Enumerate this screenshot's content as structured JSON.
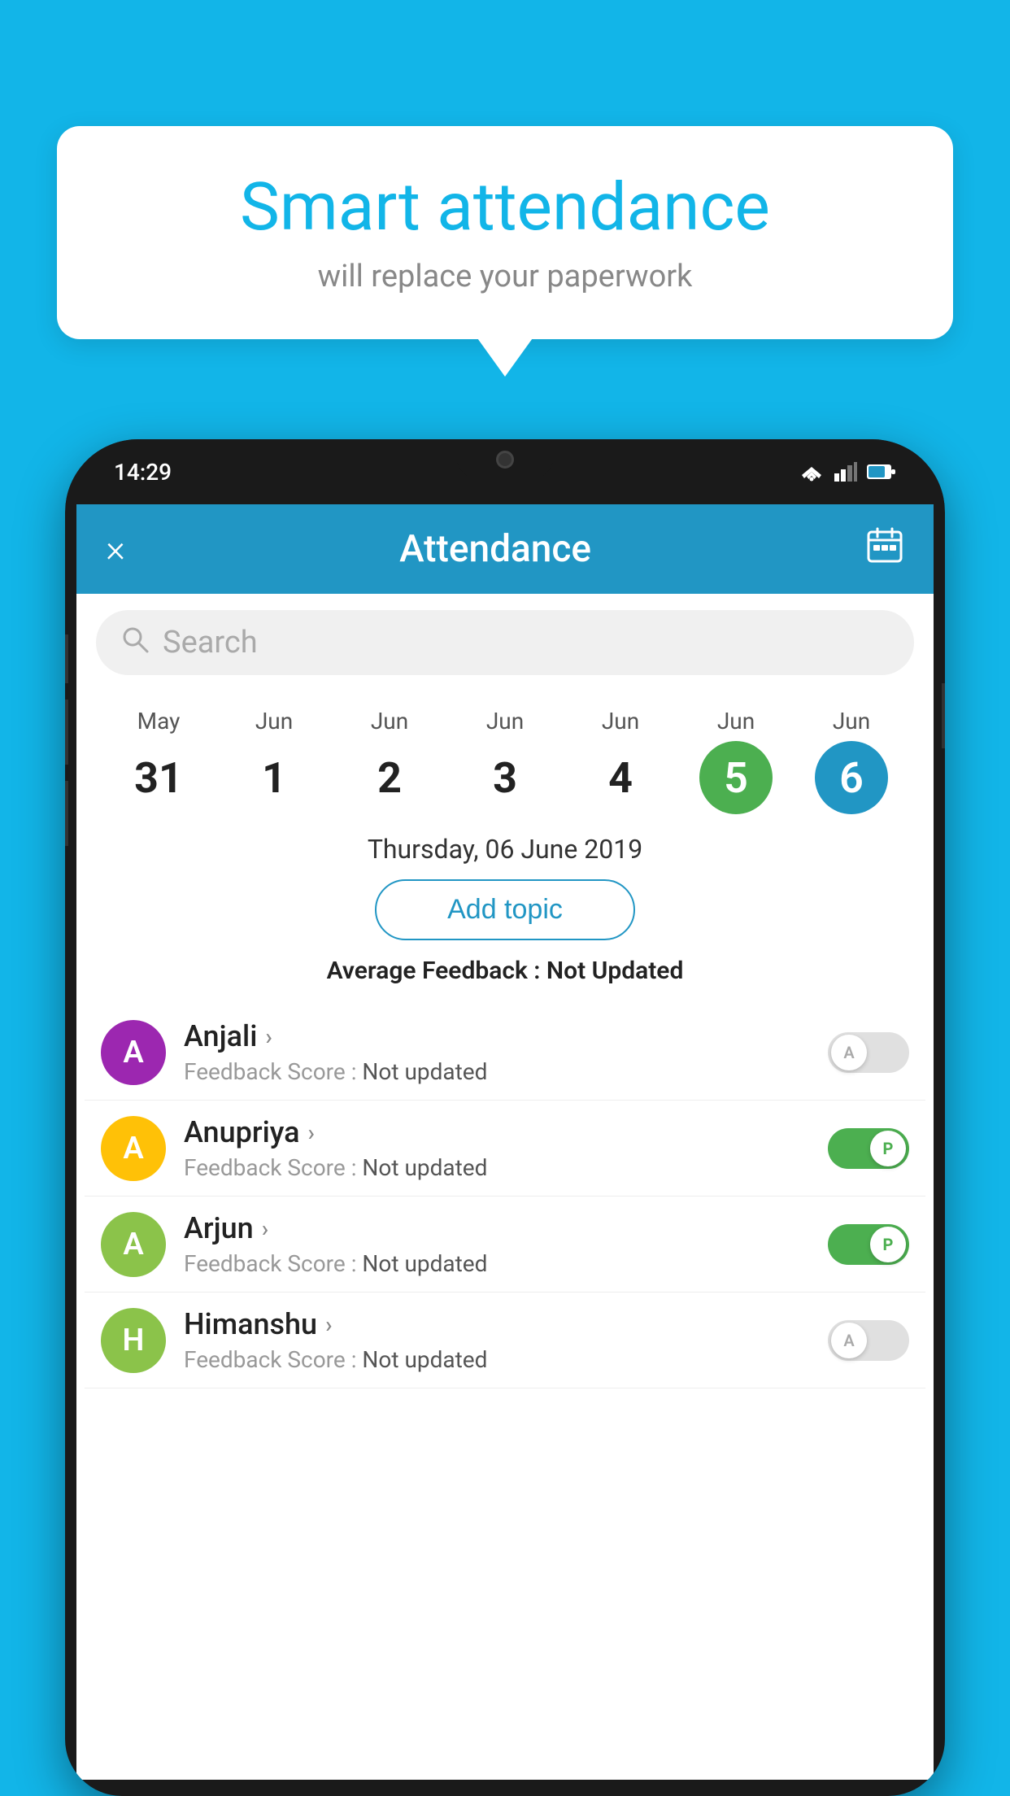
{
  "background_color": "#12B5E8",
  "bubble": {
    "title": "Smart attendance",
    "subtitle": "will replace your paperwork"
  },
  "status_bar": {
    "time": "14:29"
  },
  "app_header": {
    "title": "Attendance",
    "close_label": "×",
    "calendar_icon": "calendar"
  },
  "search": {
    "placeholder": "Search"
  },
  "calendar": {
    "days": [
      {
        "month": "May",
        "day": "31",
        "style": "normal"
      },
      {
        "month": "Jun",
        "day": "1",
        "style": "normal"
      },
      {
        "month": "Jun",
        "day": "2",
        "style": "normal"
      },
      {
        "month": "Jun",
        "day": "3",
        "style": "normal"
      },
      {
        "month": "Jun",
        "day": "4",
        "style": "normal"
      },
      {
        "month": "Jun",
        "day": "5",
        "style": "green"
      },
      {
        "month": "Jun",
        "day": "6",
        "style": "blue"
      }
    ]
  },
  "selected_date": "Thursday, 06 June 2019",
  "add_topic_button": "Add topic",
  "average_feedback": {
    "label": "Average Feedback : ",
    "value": "Not Updated"
  },
  "students": [
    {
      "name": "Anjali",
      "avatar_letter": "A",
      "avatar_color": "#9C27B0",
      "feedback_label": "Feedback Score : ",
      "feedback_value": "Not updated",
      "attendance": "A",
      "attendance_on": false
    },
    {
      "name": "Anupriya",
      "avatar_letter": "A",
      "avatar_color": "#FFC107",
      "feedback_label": "Feedback Score : ",
      "feedback_value": "Not updated",
      "attendance": "P",
      "attendance_on": true
    },
    {
      "name": "Arjun",
      "avatar_letter": "A",
      "avatar_color": "#8BC34A",
      "feedback_label": "Feedback Score : ",
      "feedback_value": "Not updated",
      "attendance": "P",
      "attendance_on": true
    },
    {
      "name": "Himanshu",
      "avatar_letter": "H",
      "avatar_color": "#8BC34A",
      "feedback_label": "Feedback Score : ",
      "feedback_value": "Not updated",
      "attendance": "A",
      "attendance_on": false
    }
  ]
}
